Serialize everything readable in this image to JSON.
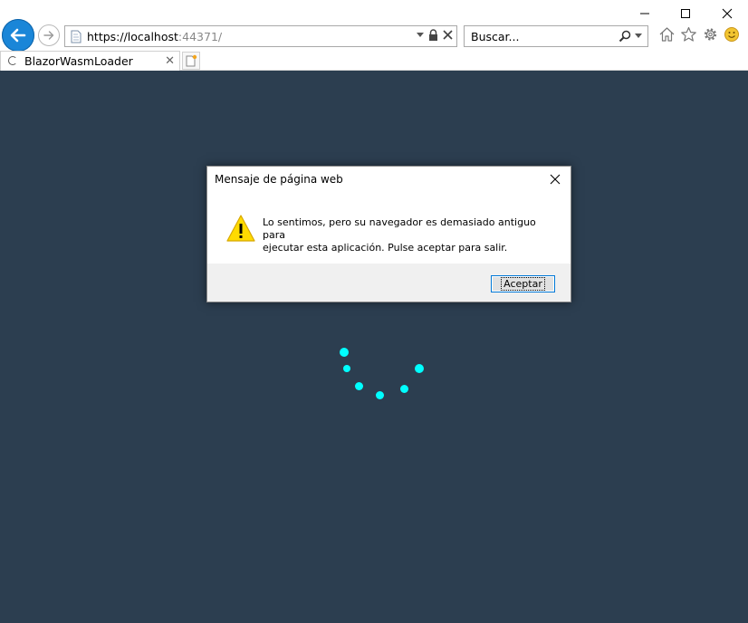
{
  "browser": {
    "address": {
      "scheme_host": "https://localhost",
      "port_path": ":44371/"
    },
    "search": {
      "placeholder": "Buscar..."
    },
    "tab": {
      "title": "BlazorWasmLoader"
    },
    "icons": [
      "back-arrow-icon",
      "forward-arrow-icon",
      "page-icon",
      "dropdown-icon",
      "lock-icon",
      "stop-icon",
      "search-icon",
      "home-icon",
      "favorites-star-icon",
      "gear-icon",
      "smiley-icon",
      "new-tab-icon",
      "minimize-icon",
      "maximize-icon",
      "close-icon"
    ]
  },
  "page": {
    "background": "#2c3e50",
    "spinner_color": "#00ffff"
  },
  "dialog": {
    "title": "Mensaje de página web",
    "message_line1": "Lo sentimos, pero su navegador es demasiado antiguo para",
    "message_line2": "ejecutar esta aplicación. Pulse aceptar para salir.",
    "ok_label": "Aceptar"
  }
}
